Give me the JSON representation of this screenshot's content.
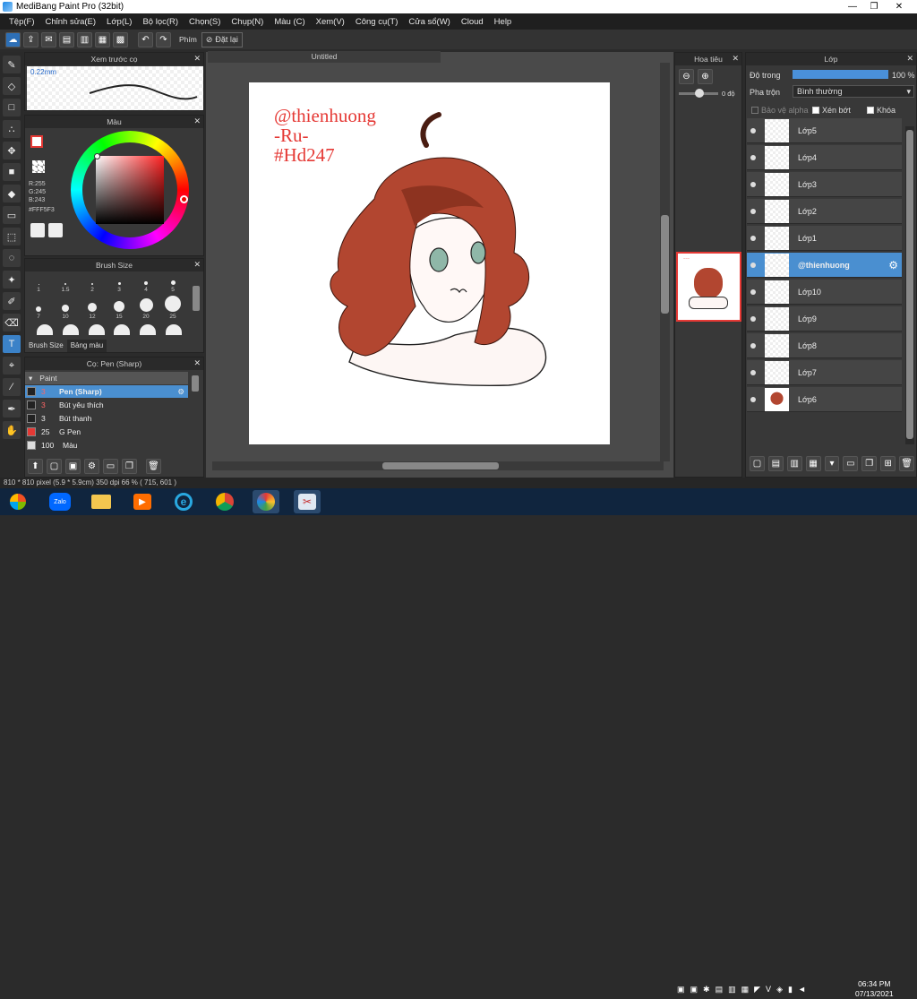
{
  "window": {
    "title": "MediBang Paint Pro (32bit)",
    "minimize": "—",
    "maximize": "❐",
    "close": "✕"
  },
  "menu": [
    "Tệp(F)",
    "Chỉnh sửa(E)",
    "Lớp(L)",
    "Bộ lọc(R)",
    "Chọn(S)",
    "Chụp(N)",
    "Màu (C)",
    "Xem(V)",
    "Công cụ(T)",
    "Cửa sổ(W)",
    "Cloud",
    "Help"
  ],
  "toolbar": {
    "key_label": "Phím",
    "reset_label": "Đặt lại"
  },
  "preview_panel": {
    "title": "Xem trước cọ",
    "size": "0.22mm"
  },
  "color_panel": {
    "title": "Màu",
    "r": "R:255",
    "g": "G:245",
    "b": "B:243",
    "hex": "#FFF5F3",
    "primary": "#FFF5F3"
  },
  "brush_size_panel": {
    "title": "Brush Size",
    "sizes": [
      "1",
      "1.5",
      "2",
      "3",
      "4",
      "5",
      "7",
      "10",
      "12",
      "15",
      "20",
      "25"
    ],
    "tabs": [
      "Brush Size",
      "Bảng màu"
    ]
  },
  "brush_panel": {
    "title": "Cọ: Pen (Sharp)",
    "group": "Paint",
    "brushes": [
      {
        "size": "3",
        "name": "Pen (Sharp)",
        "selected": true
      },
      {
        "size": "3",
        "name": "Bút yêu thích",
        "selected": false
      },
      {
        "size": "3",
        "name": "Bút thanh",
        "selected": false
      },
      {
        "size": "25",
        "name": "G Pen",
        "selected": false
      },
      {
        "size": "100",
        "name": "Màu",
        "selected": false
      }
    ]
  },
  "document": {
    "tab": "Untitled",
    "watermark": [
      "@thienhuong",
      "-Ru-",
      "#Hd247"
    ]
  },
  "navigator": {
    "title": "Hoa tiêu",
    "angle": "0 độ"
  },
  "layer_panel": {
    "title": "Lớp",
    "opacity_label": "Độ trong",
    "opacity_value": "100 %",
    "opacity_fraction": 1.0,
    "blend_label": "Pha trộn",
    "blend_value": "Bình thường",
    "protect_alpha": "Bảo vệ alpha",
    "clipping": "Xén bớt",
    "lock": "Khóa",
    "layers": [
      {
        "name": "Lớp5",
        "selected": false
      },
      {
        "name": "Lớp4",
        "selected": false
      },
      {
        "name": "Lớp3",
        "selected": false
      },
      {
        "name": "Lớp2",
        "selected": false
      },
      {
        "name": "Lớp1",
        "selected": false
      },
      {
        "name": "@thienhuong",
        "selected": true
      },
      {
        "name": "Lớp10",
        "selected": false
      },
      {
        "name": "Lớp9",
        "selected": false
      },
      {
        "name": "Lớp8",
        "selected": false
      },
      {
        "name": "Lớp7",
        "selected": false
      },
      {
        "name": "Lớp6",
        "selected": false
      }
    ]
  },
  "status": {
    "text": "810 * 810 pixel  (5.9 * 5.9cm)  350 dpi  66 %  ( 715, 601 )"
  },
  "taskbar": {
    "zalo": "Zalo",
    "time": "06:34 PM",
    "date": "07/13/2021"
  }
}
